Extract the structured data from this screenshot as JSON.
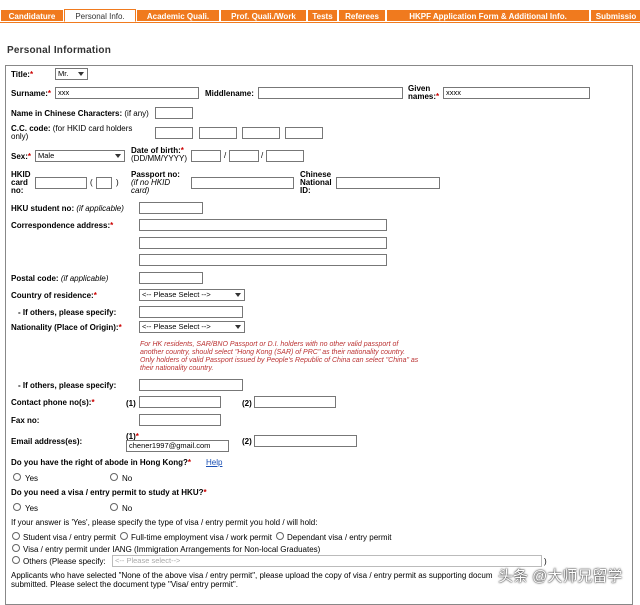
{
  "tabs": [
    {
      "label": "Candidature",
      "active": false
    },
    {
      "label": "Personal Info.",
      "active": true
    },
    {
      "label": "Academic Quali.",
      "active": false
    },
    {
      "label": "Prof. Quali./Work",
      "active": false
    },
    {
      "label": "Tests",
      "active": false
    },
    {
      "label": "Referees",
      "active": false
    },
    {
      "label": "HKPF Application Form & Additional Info.",
      "active": false
    },
    {
      "label": "Submissio",
      "active": false
    }
  ],
  "section_title": "Personal Information",
  "title": {
    "label": "Title:",
    "value": "Mr."
  },
  "surname": {
    "label": "Surname:",
    "value": "xxx"
  },
  "middlename": {
    "label": "Middlename:",
    "value": ""
  },
  "given_names": {
    "label": "Given names:",
    "value": "xxxx"
  },
  "chinese_name": {
    "label": "Name in Chinese Characters:",
    "hint": "(if any)"
  },
  "cc_code": {
    "label": "C.C. code:",
    "hint": "(for HKID card holders only)"
  },
  "sex": {
    "label": "Sex:",
    "value": "Male"
  },
  "dob": {
    "label": "Date of birth:",
    "hint": "(DD/MM/YYYY)",
    "sep": "/"
  },
  "hkid": {
    "label": "HKID card no:",
    "paren_open": "(",
    "paren_close": ")"
  },
  "passport": {
    "label": "Passport no:",
    "hint": "(if no HKID card)"
  },
  "cn_id": {
    "label": "Chinese National ID:"
  },
  "hku_student": {
    "label": "HKU student no:",
    "hint": "(if applicable)"
  },
  "correspondence": {
    "label": "Correspondence address:"
  },
  "postal": {
    "label": "Postal code:",
    "hint": "(if applicable)"
  },
  "country": {
    "label": "Country of residence:",
    "value": "<-- Please Select -->"
  },
  "if_others_1": {
    "label": "- If others, please specify:"
  },
  "nationality": {
    "label": "Nationality (Place of Origin):",
    "value": "<-- Please Select -->"
  },
  "nationality_note": [
    "For HK residents, SAR/BNO Passport or D.I. holders with no other valid passport of",
    "another country, should select \"Hong Kong (SAR) of PRC\" as their nationality country.",
    "Only holders of valid Passport issued by People's Republic of China can select \"China\" as",
    "their nationality country."
  ],
  "if_others_2": {
    "label": "- If others, please specify:"
  },
  "contact": {
    "label": "Contact phone no(s):",
    "n1": "(1)",
    "n2": "(2)"
  },
  "fax": {
    "label": "Fax no:"
  },
  "email": {
    "label": "Email address(es):",
    "n1": "(1)",
    "n2": "(2)",
    "value1": "chener1997@gmail.com"
  },
  "abode": {
    "label": "Do you have the right of abode in Hong Kong?",
    "help": "Help",
    "yes": "Yes",
    "no": "No"
  },
  "visa": {
    "label": "Do you need a visa / entry permit to study at HKU?",
    "yes": "Yes",
    "no": "No"
  },
  "visa_type_prompt": "If your answer is 'Yes', please specify the type of visa / entry permit you hold / will hold:",
  "visa_types": {
    "student": "Student visa / entry permit",
    "employment": "Full-time employment visa / work permit",
    "dependant": "Dependant visa / entry permit",
    "iang": "Visa / entry permit under IANG (Immigration Arrangements for Non-local Graduates)",
    "others": "Others (Please specify:",
    "others_select": "<-- Please select-->",
    "others_close": ")"
  },
  "footer_text": [
    "Applicants who have selected \"None of the above visa / entry permit\", please upload the copy of visa / entry permit as supporting docum",
    "submitted. Please select the document type \"Visa/ entry permit\"."
  ],
  "watermark": "头条 @大师兄留学",
  "colors": {
    "tab_bg": "#f07a1e",
    "note": "#b33333",
    "required": "#cc0000",
    "link": "#1a4fb3"
  }
}
